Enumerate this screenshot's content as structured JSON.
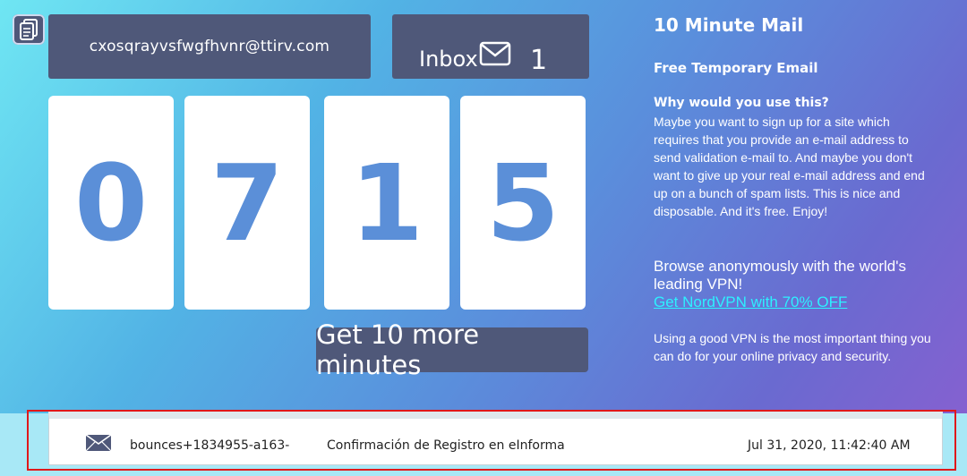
{
  "email": {
    "address": "cxosqrayvsfwgfhvnr@ttirv.com"
  },
  "inbox": {
    "label": "Inbox",
    "count": "1"
  },
  "timer": {
    "digits": [
      "0",
      "7",
      "1",
      "5"
    ]
  },
  "actions": {
    "more_minutes": "Get 10 more minutes"
  },
  "sidebar": {
    "title": "10 Minute Mail",
    "subtitle": "Free Temporary Email",
    "why_heading": "Why would you use this?",
    "why_text": "Maybe you want to sign up for a site which requires that you provide an e-mail address to send validation e-mail to. And maybe you don't want to give up your real e-mail address and end up on a bunch of spam lists. This is nice and disposable. And it's free. Enjoy!",
    "vpn_text": "Browse anonymously with the world's leading VPN!",
    "vpn_link": "Get NordVPN with 70% OFF",
    "vpn_note": "Using a good VPN is the most important thing you can do for your online privacy and security."
  },
  "messages": [
    {
      "from": "bounces+1834955-a163-",
      "subject": "Confirmación de Registro en eInforma",
      "date": "Jul 31, 2020, 11:42:40 AM"
    }
  ],
  "colors": {
    "panel": "#4f5879",
    "digit_text": "#5b8fd8",
    "link": "#2df0ff",
    "highlight": "#e0181a"
  },
  "icons": {
    "copy": "copy-icon",
    "inbox": "envelope-icon",
    "message": "envelope-icon"
  }
}
